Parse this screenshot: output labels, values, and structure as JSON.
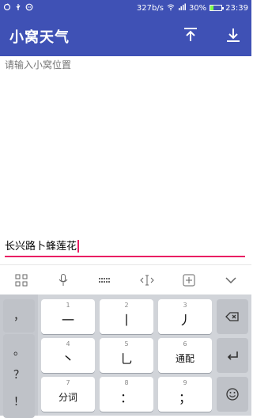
{
  "status": {
    "speed": "327b/s",
    "battery": "30%",
    "time": "23:39",
    "battery_level": 0.3,
    "icons": [
      "sync-icon",
      "usb-icon",
      "message-icon",
      "wifi-icon",
      "signal-icon",
      "battery-icon"
    ]
  },
  "appbar": {
    "title": "小窝天气",
    "actions": [
      "upload-icon",
      "download-icon"
    ],
    "color": "#3f51b5"
  },
  "content": {
    "placeholder": "请输入小窝位置",
    "input_value": "长兴路卜蜂莲花",
    "accent": "#e91e63"
  },
  "toolbar": {
    "icons": [
      "grid-icon",
      "microphone-icon",
      "keyboard-icon",
      "cursor-move-icon",
      "add-box-icon",
      "collapse-icon"
    ]
  },
  "keyboard": {
    "left_keys": [
      "，",
      "。",
      "？",
      "！"
    ],
    "rows": [
      [
        {
          "sub": "1",
          "label": "一"
        },
        {
          "sub": "2",
          "label": "丨"
        },
        {
          "sub": "3",
          "label": "丿"
        }
      ],
      [
        {
          "sub": "4",
          "label": "丶"
        },
        {
          "sub": "5",
          "label": "乚"
        },
        {
          "sub": "6",
          "label": "通配"
        }
      ],
      [
        {
          "sub": "7",
          "label": "分词"
        },
        {
          "sub": "8",
          "label": "："
        },
        {
          "sub": "9",
          "label": "；"
        }
      ]
    ],
    "right_keys": [
      "backspace-icon",
      "enter-icon",
      "emoji-icon"
    ]
  }
}
